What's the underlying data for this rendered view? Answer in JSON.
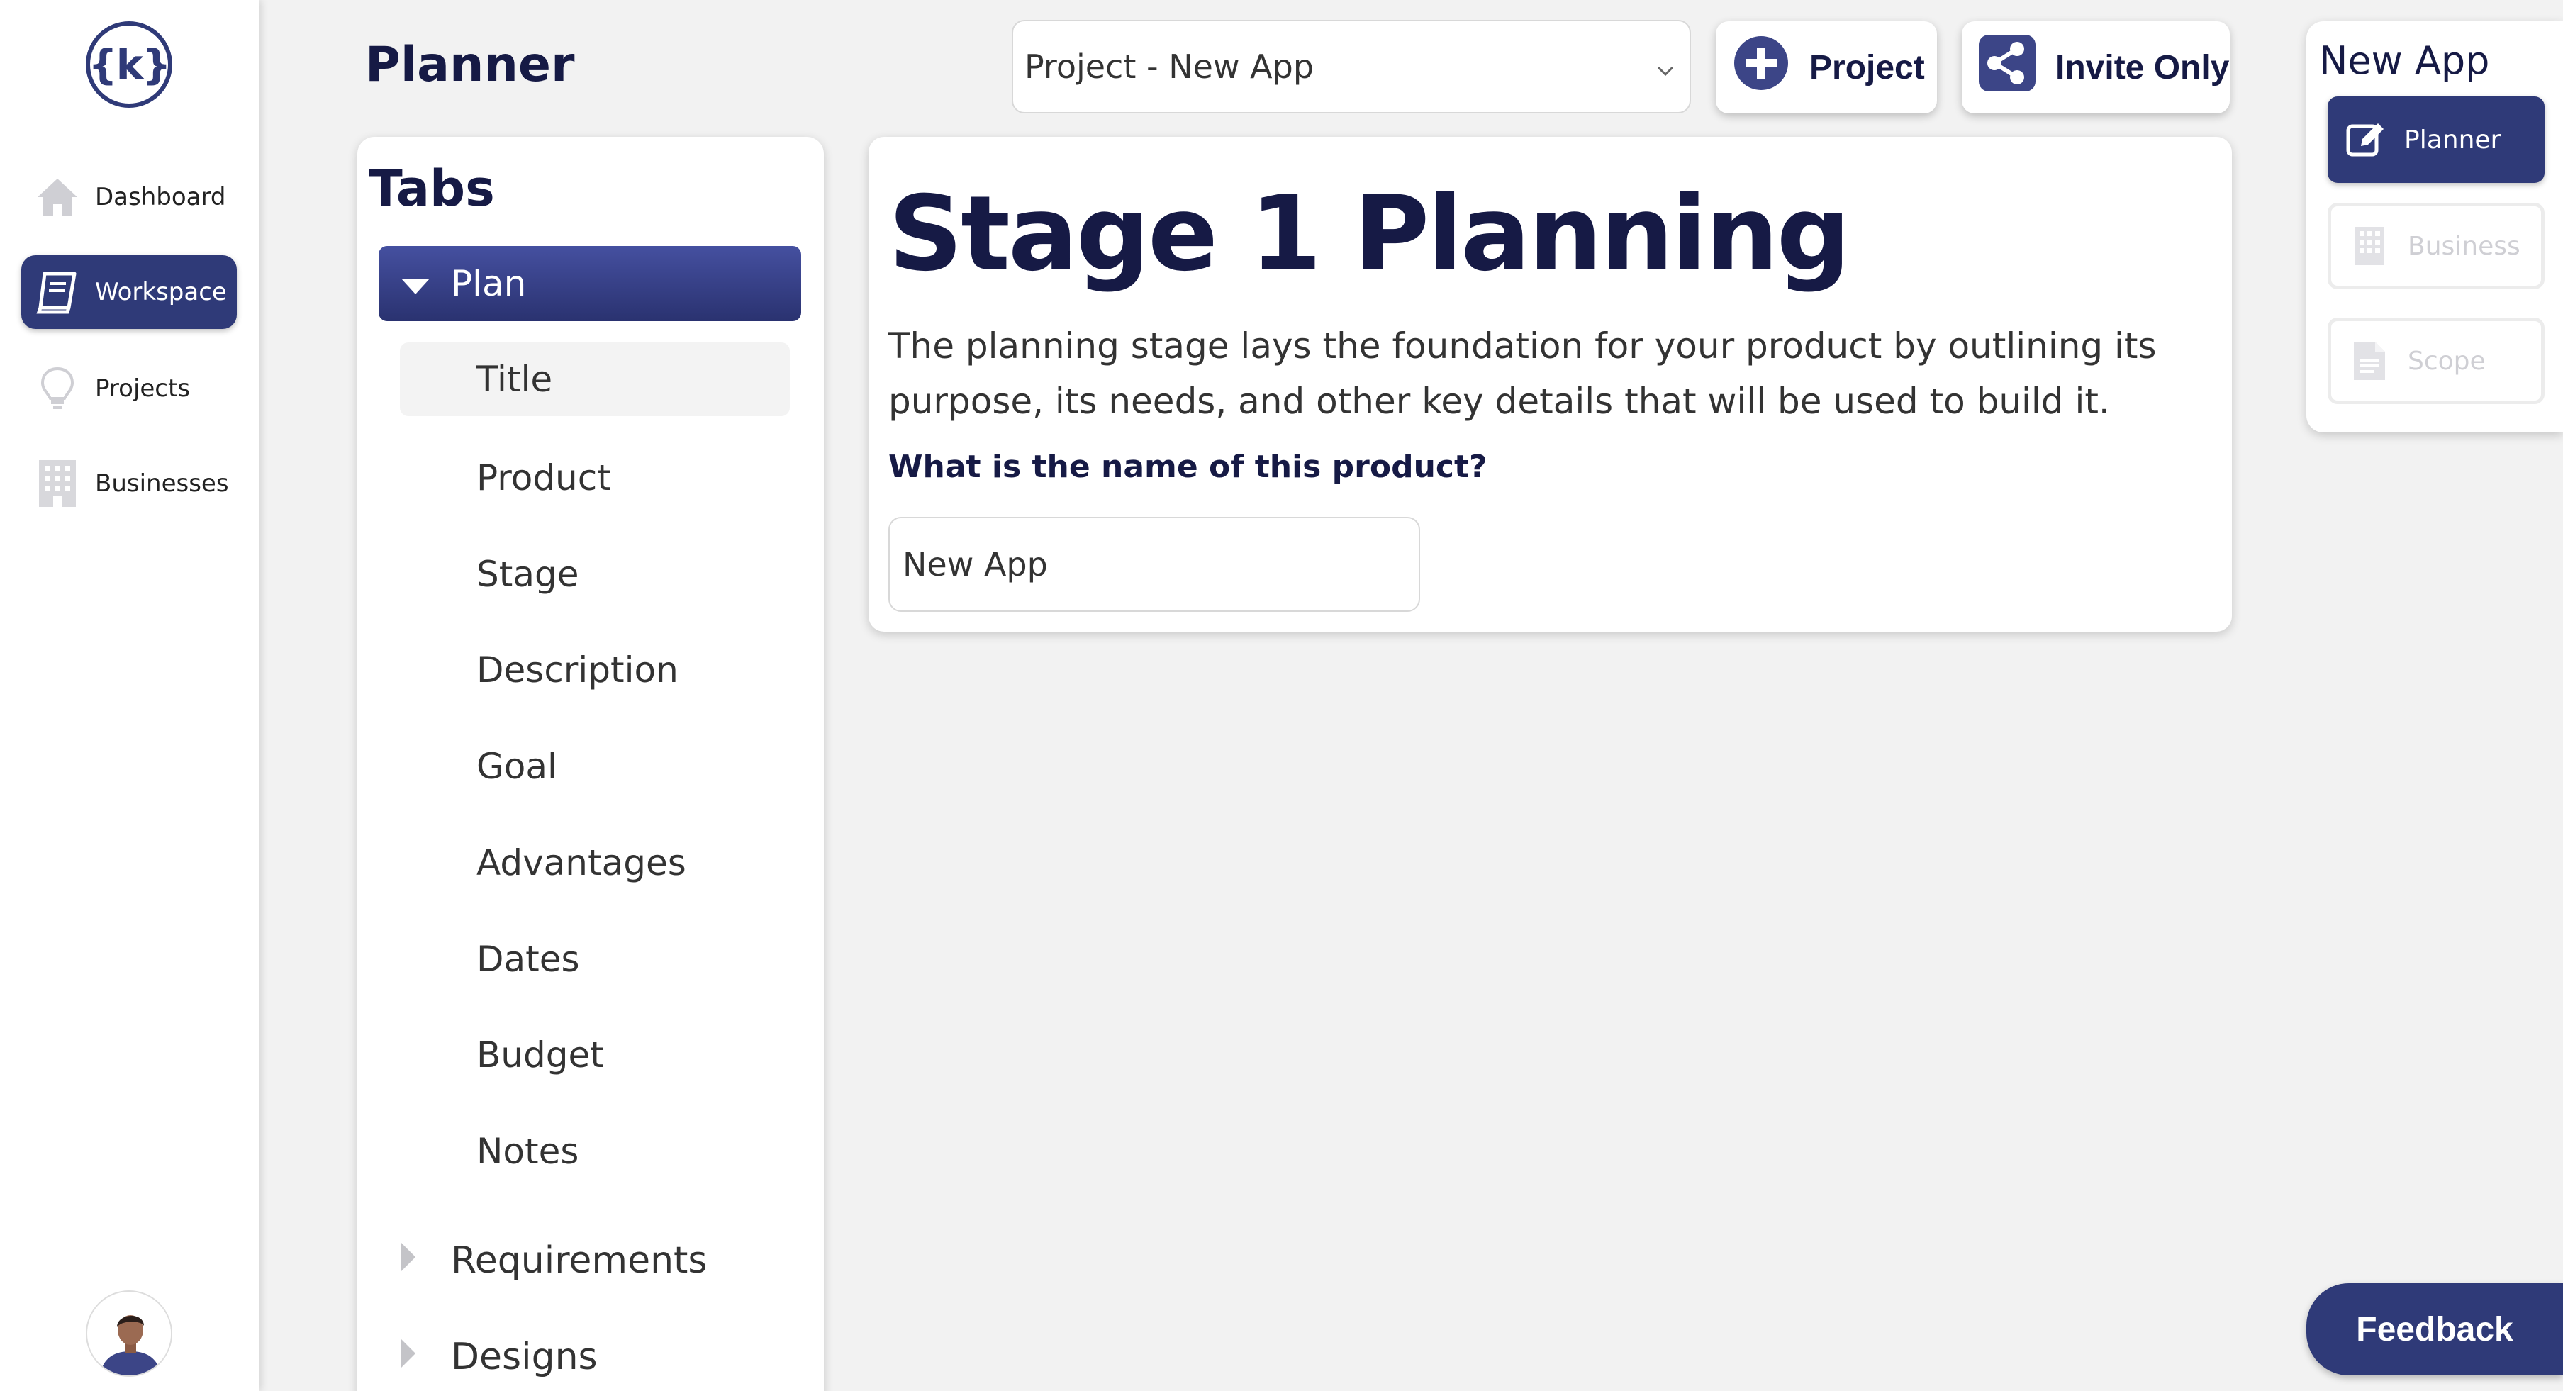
{
  "app": {
    "logo_text": "{k}"
  },
  "leftnav": {
    "items": [
      {
        "label": "Dashboard",
        "icon": "home-icon"
      },
      {
        "label": "Workspace",
        "icon": "notebook-icon",
        "active": true
      },
      {
        "label": "Projects",
        "icon": "lightbulb-icon"
      },
      {
        "label": "Businesses",
        "icon": "building-icon"
      }
    ]
  },
  "header": {
    "title": "Planner",
    "project_select": {
      "value": "Project - New App"
    },
    "add_project_label": "Project",
    "share_label": "Invite Only"
  },
  "tabs": {
    "title": "Tabs",
    "groups": [
      {
        "label": "Plan",
        "expanded": true,
        "items": [
          "Title",
          "Product",
          "Stage",
          "Description",
          "Goal",
          "Advantages",
          "Dates",
          "Budget",
          "Notes"
        ],
        "selected": "Title"
      },
      {
        "label": "Requirements",
        "expanded": false
      },
      {
        "label": "Designs",
        "expanded": false
      }
    ]
  },
  "main": {
    "heading": "Stage 1 Planning",
    "description": "The planning stage lays the foundation for your product by outlining its purpose, its needs, and other key details that will be used to build it.",
    "question": "What is the name of this product?",
    "product_name_value": "New App"
  },
  "right_panel": {
    "title": "New App",
    "items": [
      {
        "label": "Planner",
        "icon": "edit-icon",
        "state": "active"
      },
      {
        "label": "Business",
        "icon": "building-icon",
        "state": "disabled"
      },
      {
        "label": "Scope",
        "icon": "document-icon",
        "state": "disabled"
      }
    ]
  },
  "feedback_label": "Feedback",
  "colors": {
    "accent": "#2f3a78",
    "ink": "#161a45"
  }
}
